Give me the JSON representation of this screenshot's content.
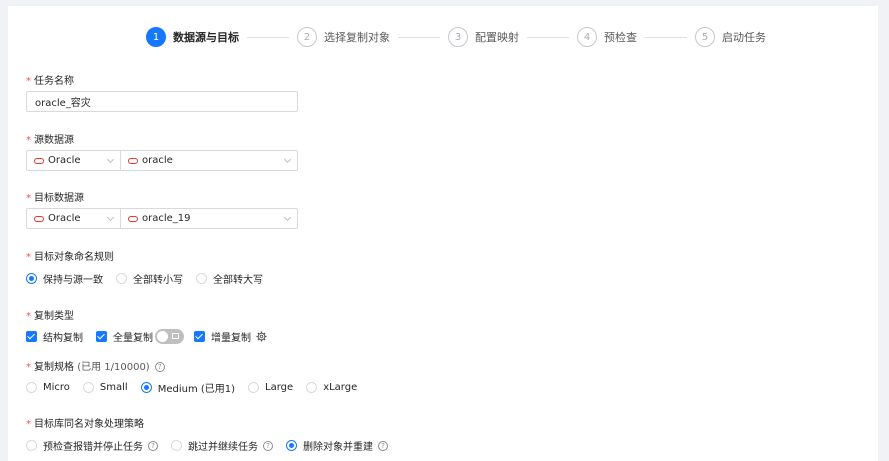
{
  "steps": [
    {
      "num": "1",
      "label": "数据源与目标"
    },
    {
      "num": "2",
      "label": "选择复制对象"
    },
    {
      "num": "3",
      "label": "配置映射"
    },
    {
      "num": "4",
      "label": "预检查"
    },
    {
      "num": "5",
      "label": "启动任务"
    }
  ],
  "form": {
    "required_mark": "*",
    "task_name": {
      "label": "任务名称",
      "value": "oracle_容灾"
    },
    "source": {
      "label": "源数据源",
      "type": "Oracle",
      "instance": "oracle"
    },
    "target": {
      "label": "目标数据源",
      "type": "Oracle",
      "instance": "oracle_19"
    },
    "naming_rule": {
      "label": "目标对象命名规则",
      "options": [
        "保持与源一致",
        "全部转小写",
        "全部转大写"
      ],
      "selected": "保持与源一致"
    },
    "copy_type": {
      "label": "复制类型",
      "structure": "结构复制",
      "full": "全量复制",
      "incremental": "增量复制"
    },
    "spec": {
      "label": "复制规格",
      "usage": "(已用 1/10000)",
      "help": "?",
      "options": [
        "Micro",
        "Small",
        "Medium (已用1)",
        "Large",
        "xLarge"
      ],
      "selected": "Medium (已用1)"
    },
    "conflict": {
      "label": "目标库同名对象处理策略",
      "options": [
        "预检查报错并停止任务",
        "跳过并继续任务",
        "删除对象并重建"
      ],
      "selected": "删除对象并重建",
      "help": "?"
    }
  },
  "icons": {
    "db": "oracle-db-icon",
    "gear": "gear-icon",
    "help": "help-circle-icon"
  },
  "colors": {
    "primary": "#1677ff",
    "required": "#ff4d4f",
    "oracle": "#e8362b"
  }
}
